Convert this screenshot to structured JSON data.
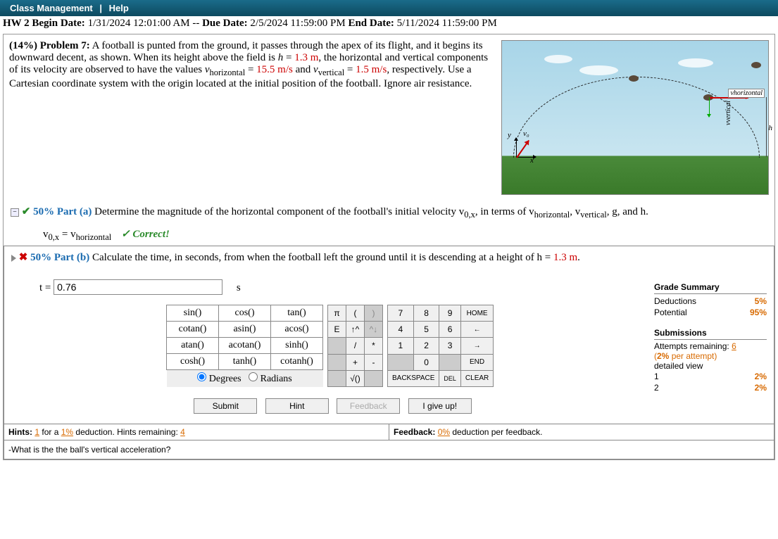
{
  "header": {
    "link1": "Class Management",
    "sep": "|",
    "link2": "Help"
  },
  "dates": {
    "hw_label": "HW 2 Begin Date:",
    "begin": "1/31/2024 12:01:00 AM",
    "dash": "--",
    "due_label": "Due Date:",
    "due": "2/5/2024 11:59:00 PM",
    "end_label": "End Date:",
    "end": "5/11/2024 11:59:00 PM"
  },
  "problem": {
    "pct": "(14%)  Problem 7:",
    "text1": "A football is punted from the ground, it passes through the apex of its flight, and it begins its downward decent, as shown. When its height above the field is ",
    "hvar": "h",
    "eq1": " = ",
    "hval": "1.3 m",
    "text2": ", the horizontal and vertical components of its velocity are observed to have the values ",
    "vhvar": "v",
    "vhsub": "horizontal",
    "eq2": " = ",
    "vhval": "15.5 m/s",
    "text3": " and ",
    "vvvar": "v",
    "vvsub": "vertical",
    "eq3": " = ",
    "vvval": "1.5 m/s",
    "text4": ", respectively. Use a Cartesian coordinate system with the origin located at the initial position of the football. Ignore air resistance."
  },
  "diagram": {
    "y": "y",
    "x": "x",
    "v0": "v₀",
    "vh": "vhorizontal",
    "vv": "vvertical",
    "h": "h"
  },
  "parta": {
    "pct": "50% Part (a)",
    "text1": "Determine the magnitude of the horizontal component of the football's initial velocity ",
    "v0x": "v",
    "v0xsub": "0,x",
    "text2": ", in terms of ",
    "vh": "v",
    "vhsub": "horizontal",
    "c1": ", ",
    "vv": "v",
    "vvsub": "vertical",
    "c2": ", ",
    "g": "g",
    "c3": ", and ",
    "h": "h",
    "dot": ".",
    "answer_lhs": "v",
    "answer_lsub": "0,x",
    "answer_eq": " = ",
    "answer_rhs": "v",
    "answer_rsub": "horizontal",
    "correct": "✓ Correct!"
  },
  "partb": {
    "pct": "50% Part (b)",
    "text1": "Calculate the time, in seconds, from when the football left the ground until it is descending at a height of ",
    "h": "h",
    "eq": " = ",
    "hval": "1.3 m",
    "dot": ".",
    "tvar": "t",
    "teq": " = ",
    "tval": "0.76",
    "tunit": "s"
  },
  "kbd_fn": [
    [
      "sin()",
      "cos()",
      "tan()"
    ],
    [
      "cotan()",
      "asin()",
      "acos()"
    ],
    [
      "atan()",
      "acotan()",
      "sinh()"
    ],
    [
      "cosh()",
      "tanh()",
      "cotanh()"
    ]
  ],
  "kbd_mode": {
    "deg": "Degrees",
    "rad": "Radians"
  },
  "kbd_sym": [
    [
      "π",
      "(",
      ")"
    ],
    [
      "E",
      "↑^",
      "^↓"
    ],
    [
      "",
      "/",
      "*"
    ],
    [
      "",
      "+",
      "-"
    ],
    [
      "",
      "√()",
      ""
    ]
  ],
  "kbd_num": [
    [
      "7",
      "8",
      "9",
      "HOME"
    ],
    [
      "4",
      "5",
      "6",
      "←"
    ],
    [
      "1",
      "2",
      "3",
      "→"
    ],
    [
      "",
      "0",
      "",
      "END"
    ],
    [
      "BACKSPACE",
      "",
      "DEL",
      "CLEAR"
    ]
  ],
  "actions": {
    "submit": "Submit",
    "hint": "Hint",
    "feedback": "Feedback",
    "giveup": "I give up!"
  },
  "grade": {
    "title": "Grade Summary",
    "ded_l": "Deductions",
    "ded_v": "5%",
    "pot_l": "Potential",
    "pot_v": "95%",
    "sub_title": "Submissions",
    "att_l": "Attempts remaining:",
    "att_v": "6",
    "per_att": "(2% per attempt)",
    "detail": "detailed view",
    "rows": [
      {
        "n": "1",
        "p": "2%"
      },
      {
        "n": "2",
        "p": "2%"
      }
    ]
  },
  "hints": {
    "left_b": "Hints:",
    "left_1": "1",
    "left_t": " for a ",
    "left_p": "1%",
    "left_t2": " deduction. Hints remaining: ",
    "left_r": "4",
    "right_b": "Feedback:",
    "right_p": "0%",
    "right_t": " deduction per feedback."
  },
  "hint_text": "-What is the the ball's vertical acceleration?"
}
